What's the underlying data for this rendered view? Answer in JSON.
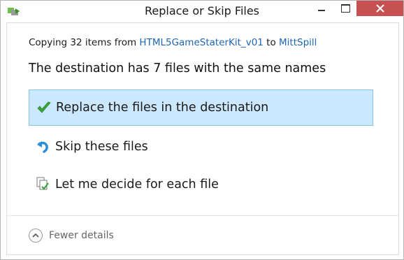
{
  "window": {
    "title": "Replace or Skip Files"
  },
  "dialog": {
    "copy_prefix": "Copying 32 items from",
    "source": "HTML5GameStaterKit_v01",
    "copy_to": "to",
    "destination": "MittSpill",
    "headline": "The destination has 7 files with the same names"
  },
  "options": [
    {
      "label": "Replace the files in the destination",
      "icon": "checkmark-icon",
      "selected": true
    },
    {
      "label": "Skip these files",
      "icon": "skip-arrow-icon",
      "selected": false
    },
    {
      "label": "Let me decide for each file",
      "icon": "decide-files-icon",
      "selected": false
    }
  ],
  "footer": {
    "details_label": "Fewer details",
    "icon": "chevron-up-icon"
  },
  "colors": {
    "link": "#1e64b4",
    "selected_bg": "#cce8ff",
    "selected_border": "#84c2ef",
    "close_button": "#c75050",
    "check_green": "#3aa53a",
    "skip_blue": "#2f8fd6"
  }
}
